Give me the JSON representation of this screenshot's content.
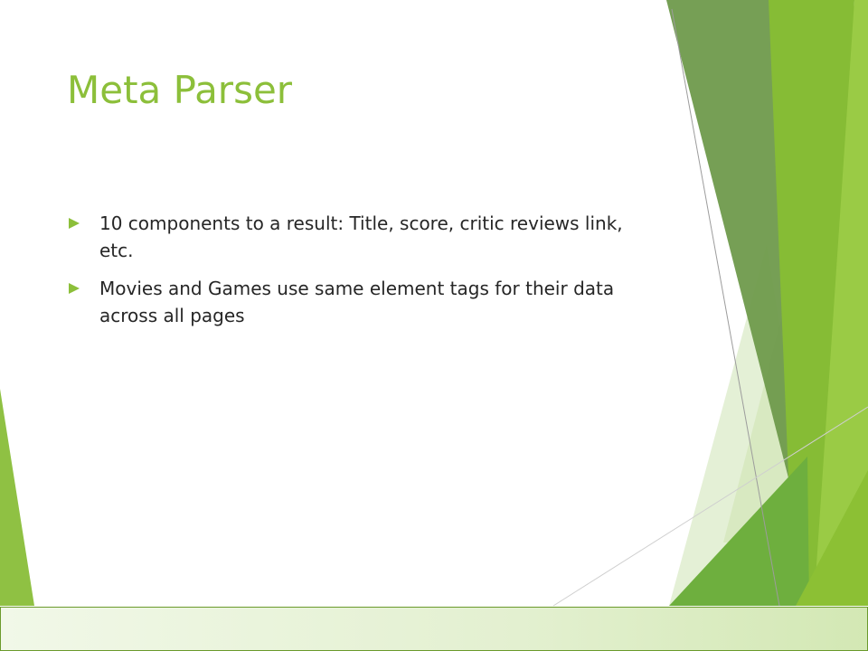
{
  "slide": {
    "title": "Meta Parser",
    "bullets": [
      "10 components to a result: Title, score, critic reviews link, etc.",
      "Movies and Games use same element tags for their data across all pages"
    ]
  },
  "colors": {
    "accent": "#8cbf3a",
    "text": "#262626",
    "dark_green": "#5f9a3a",
    "light_green": "#dbeac6"
  }
}
